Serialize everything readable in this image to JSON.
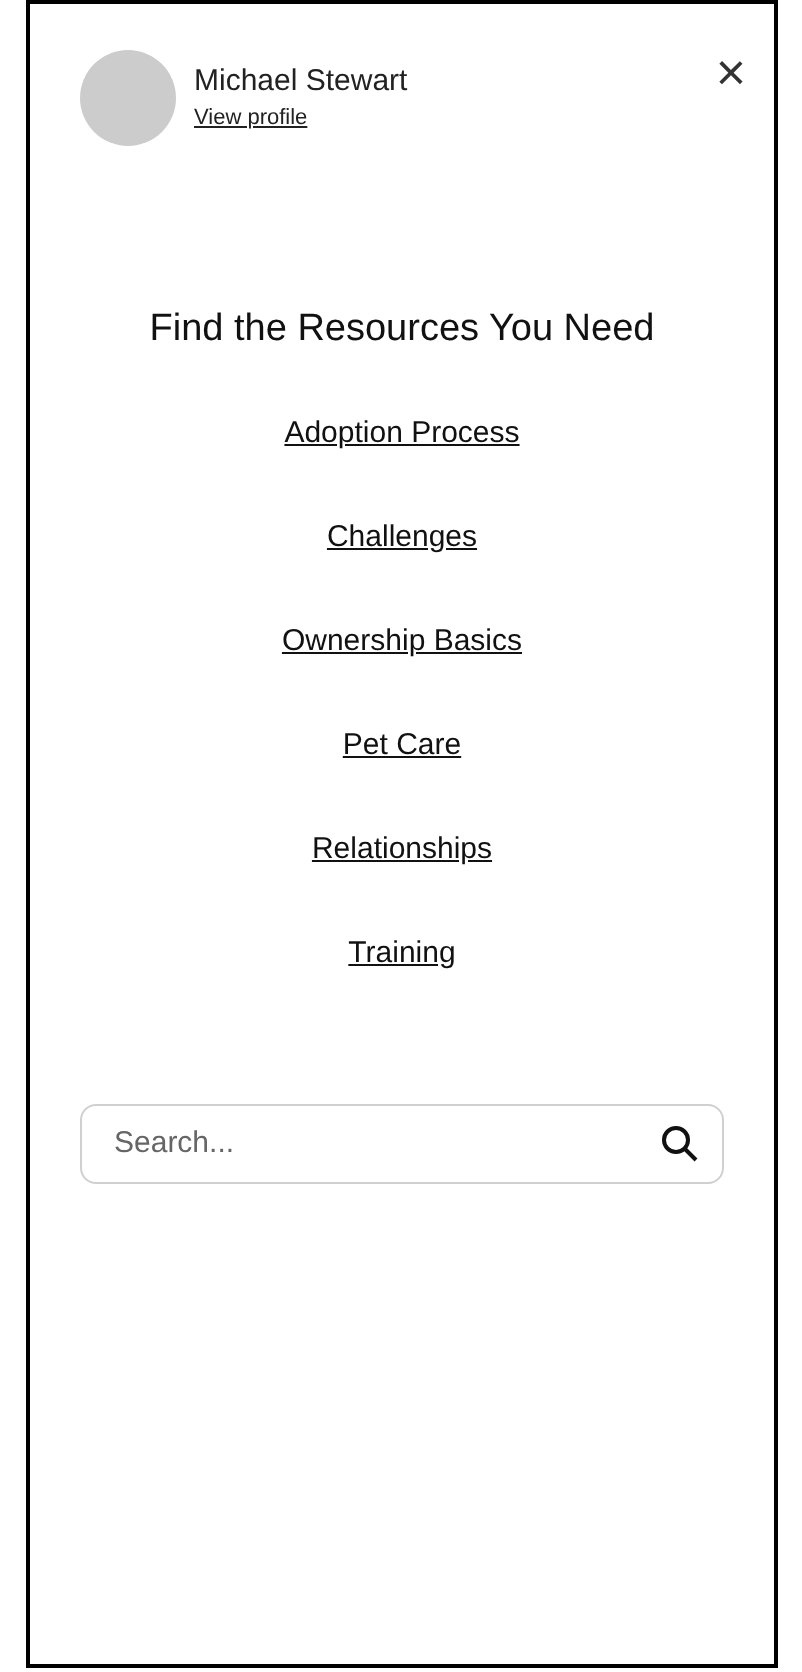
{
  "profile": {
    "name": "Michael Stewart",
    "link": "View profile"
  },
  "close_button": {
    "label": "×"
  },
  "heading": "Find the Resources You Need",
  "links": [
    "Adoption Process",
    "Challenges",
    "Ownership Basics",
    "Pet Care",
    "Relationships",
    "Training"
  ],
  "search": {
    "placeholder": "Search..."
  }
}
